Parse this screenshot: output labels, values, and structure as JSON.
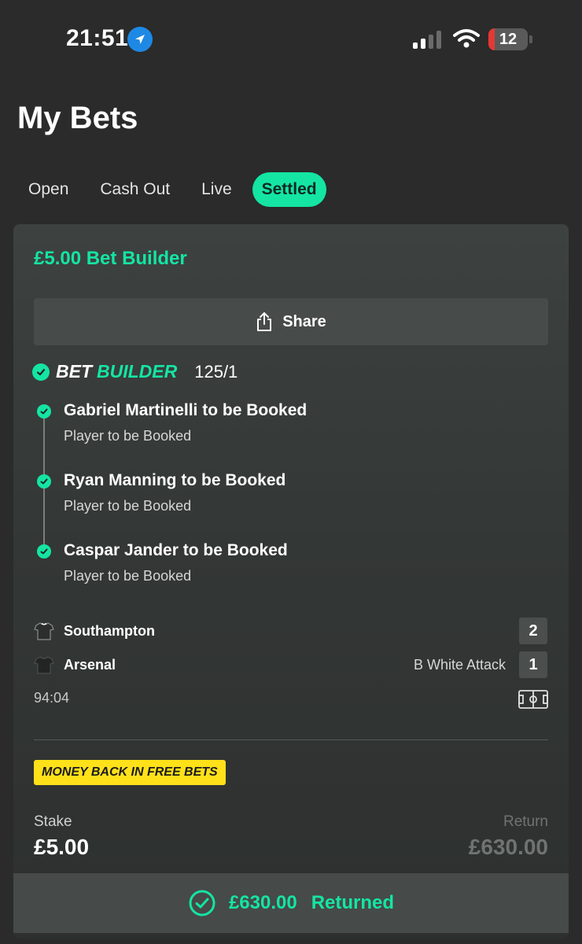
{
  "status_bar": {
    "time": "21:51",
    "battery": "12"
  },
  "page": {
    "title": "My Bets"
  },
  "tabs": [
    {
      "label": "Open"
    },
    {
      "label": "Cash Out"
    },
    {
      "label": "Live"
    },
    {
      "label": "Settled",
      "active": true
    }
  ],
  "bet": {
    "title": "£5.00 Bet Builder",
    "share_label": "Share",
    "builder_label_1": "BET",
    "builder_label_2": "BUILDER",
    "odds": "125/1",
    "legs": [
      {
        "title": "Gabriel Martinelli to be Booked",
        "market": "Player to be Booked"
      },
      {
        "title": "Ryan Manning to be Booked",
        "market": "Player to be Booked"
      },
      {
        "title": "Caspar Jander to be Booked",
        "market": "Player to be Booked"
      }
    ],
    "match": {
      "home": {
        "name": "Southampton",
        "score": "2"
      },
      "away": {
        "name": "Arsenal",
        "score": "1",
        "event": "B White Attack"
      },
      "time": "94:04"
    },
    "promo": "MONEY BACK IN FREE BETS",
    "stake_label": "Stake",
    "stake_value": "£5.00",
    "return_label": "Return",
    "return_value": "£630.00",
    "returned_amount": "£630.00",
    "returned_label": "Returned"
  },
  "colors": {
    "accent": "#14e5a3",
    "background": "#2a2b2a",
    "promo": "#ffe11a"
  }
}
